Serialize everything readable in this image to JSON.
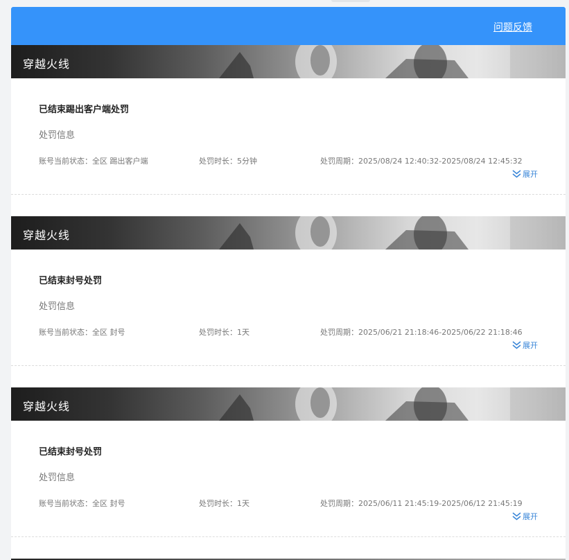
{
  "header": {
    "feedback_label": "问题反馈"
  },
  "records": [
    {
      "game": "穿越火线",
      "title": "已结束踢出客户端处罚",
      "info_label": "处罚信息",
      "status": "账号当前状态：全区 踢出客户端",
      "duration": "处罚时长：5分钟",
      "period": "处罚周期：2025/08/24 12:40:32-2025/08/24 12:45:32",
      "expand_label": "展开"
    },
    {
      "game": "穿越火线",
      "title": "已结束封号处罚",
      "info_label": "处罚信息",
      "status": "账号当前状态：全区 封号",
      "duration": "处罚时长：1天",
      "period": "处罚周期：2025/06/21 21:18:46-2025/06/22 21:18:46",
      "expand_label": "展开"
    },
    {
      "game": "穿越火线",
      "title": "已结束封号处罚",
      "info_label": "处罚信息",
      "status": "账号当前状态：全区 封号",
      "duration": "处罚时长：1天",
      "period": "处罚周期：2025/06/11 21:45:19-2025/06/12 21:45:19",
      "expand_label": "展开"
    }
  ],
  "colors": {
    "header_blue": "#3593fa",
    "link_blue": "#3a86d8"
  },
  "icons": [
    "chevron-double-down-icon"
  ]
}
